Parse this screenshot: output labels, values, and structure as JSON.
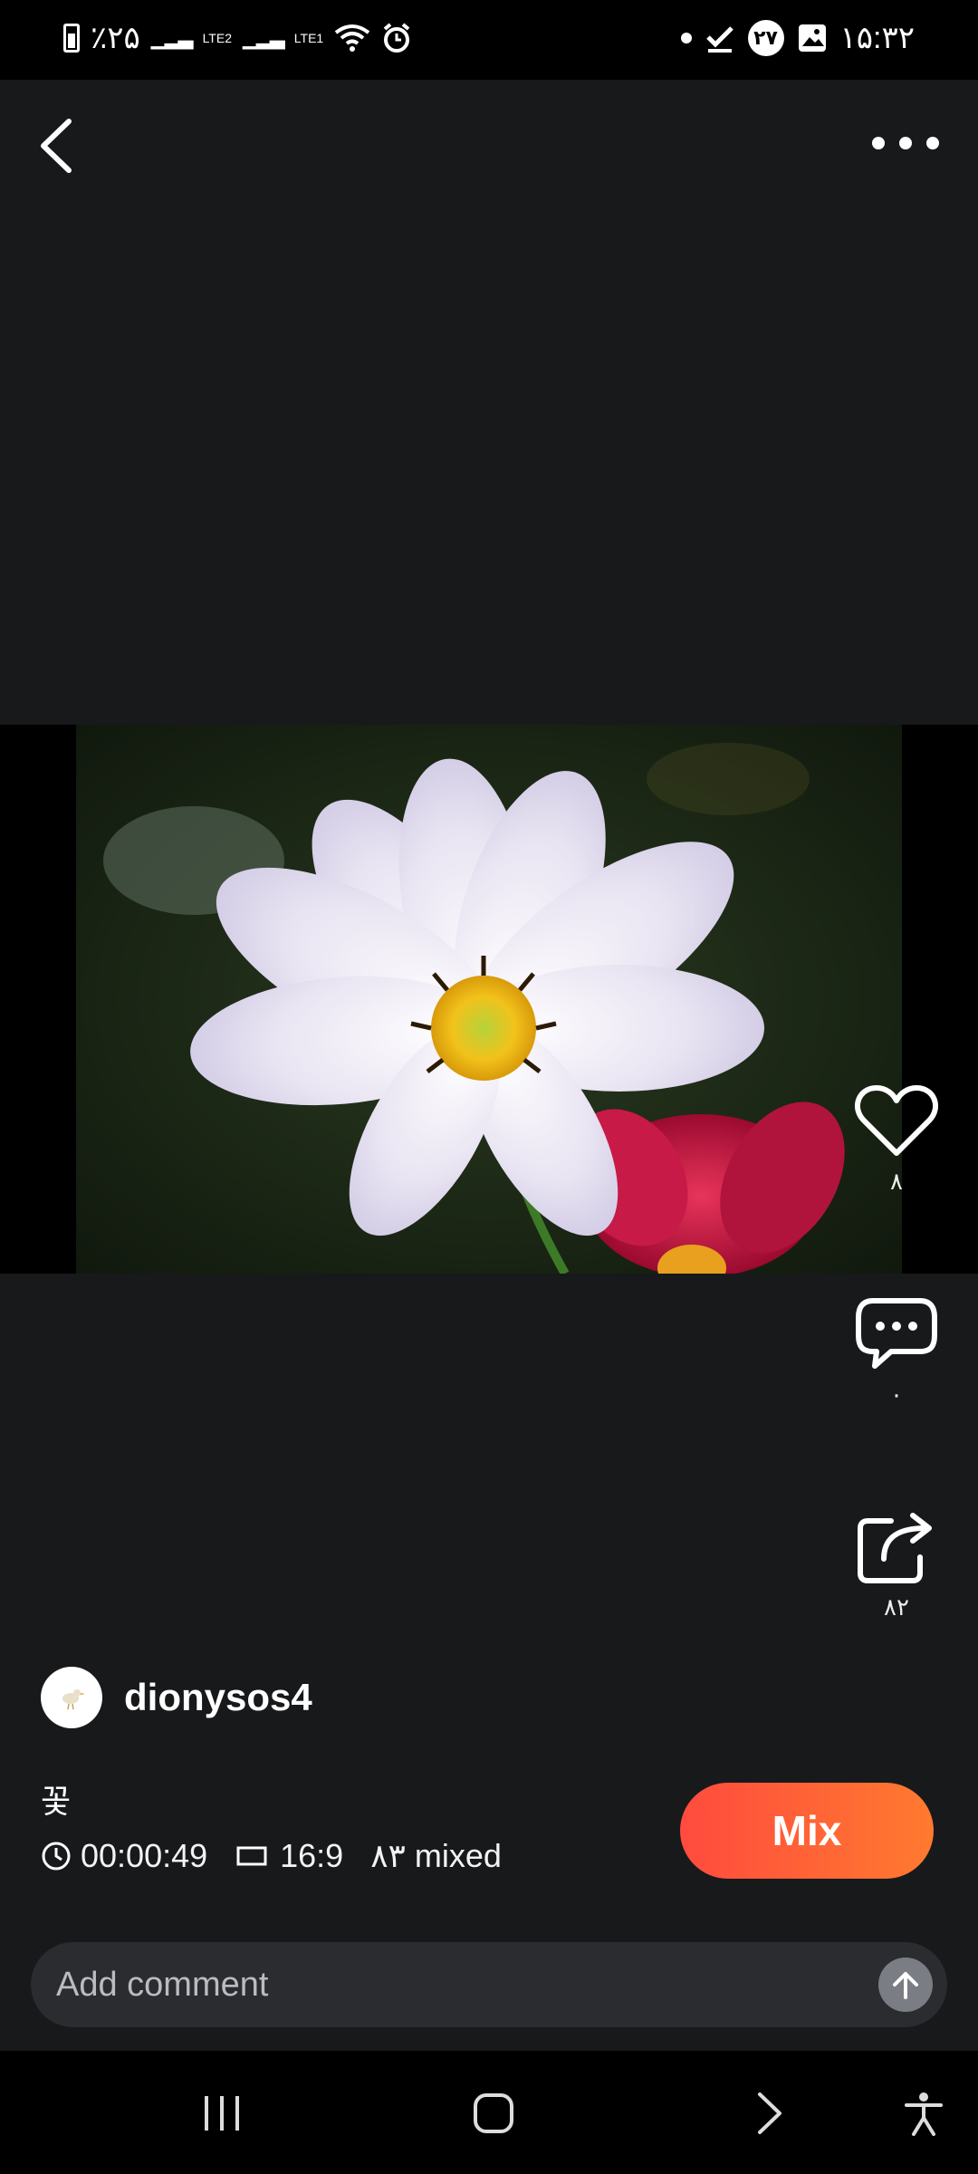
{
  "status_bar": {
    "battery": "٪۲۵",
    "lte2": "LTE2",
    "lte1": "LTE1",
    "badge": "۲۷",
    "time": "۱۵:۳۲"
  },
  "post": {
    "username": "dionysos4",
    "caption": "꽃",
    "duration": "00:00:49",
    "aspect_ratio": "16:9",
    "mixed": "۸۳ mixed",
    "mix_label": "Mix"
  },
  "actions": {
    "likes": "۸",
    "comments": "۰",
    "shares": "۸۲"
  },
  "comment": {
    "placeholder": "Add comment"
  }
}
